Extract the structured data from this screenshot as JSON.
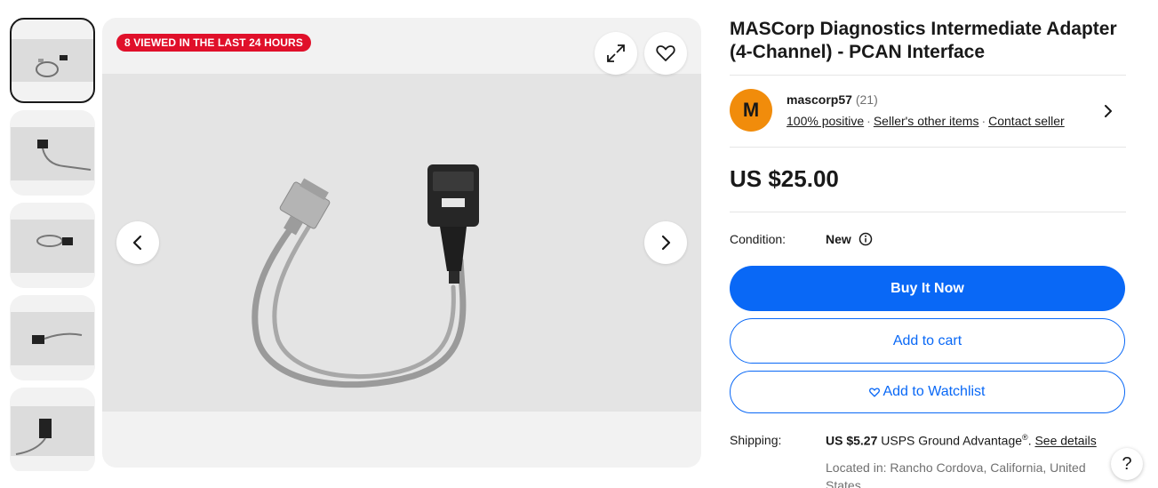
{
  "gallery": {
    "viewed_badge": "8 VIEWED IN THE LAST 24 HOURS",
    "thumbnail_count": 5
  },
  "listing": {
    "title": "MASCorp Diagnostics Intermediate Adapter (4-Channel) - PCAN Interface",
    "price": "US $25.00"
  },
  "seller": {
    "avatar_letter": "M",
    "name": "mascorp57",
    "feedback_count": "(21)",
    "positive": "100% positive",
    "other_items": "Seller's other items",
    "contact": "Contact seller",
    "separator": "·"
  },
  "condition": {
    "label": "Condition:",
    "value": "New"
  },
  "actions": {
    "buy_now": "Buy It Now",
    "add_to_cart": "Add to cart",
    "add_to_watchlist": "Add to Watchlist"
  },
  "shipping": {
    "label": "Shipping:",
    "cost": "US $5.27",
    "service": "USPS Ground Advantage",
    "registered": "®",
    "separator": ".",
    "see_details": "See details",
    "located_in": "Located in: Rancho Cordova, California, United States"
  },
  "help": {
    "label": "?"
  },
  "colors": {
    "primary": "#0968f6",
    "badge": "#e0102a",
    "avatar": "#f18c0b"
  }
}
